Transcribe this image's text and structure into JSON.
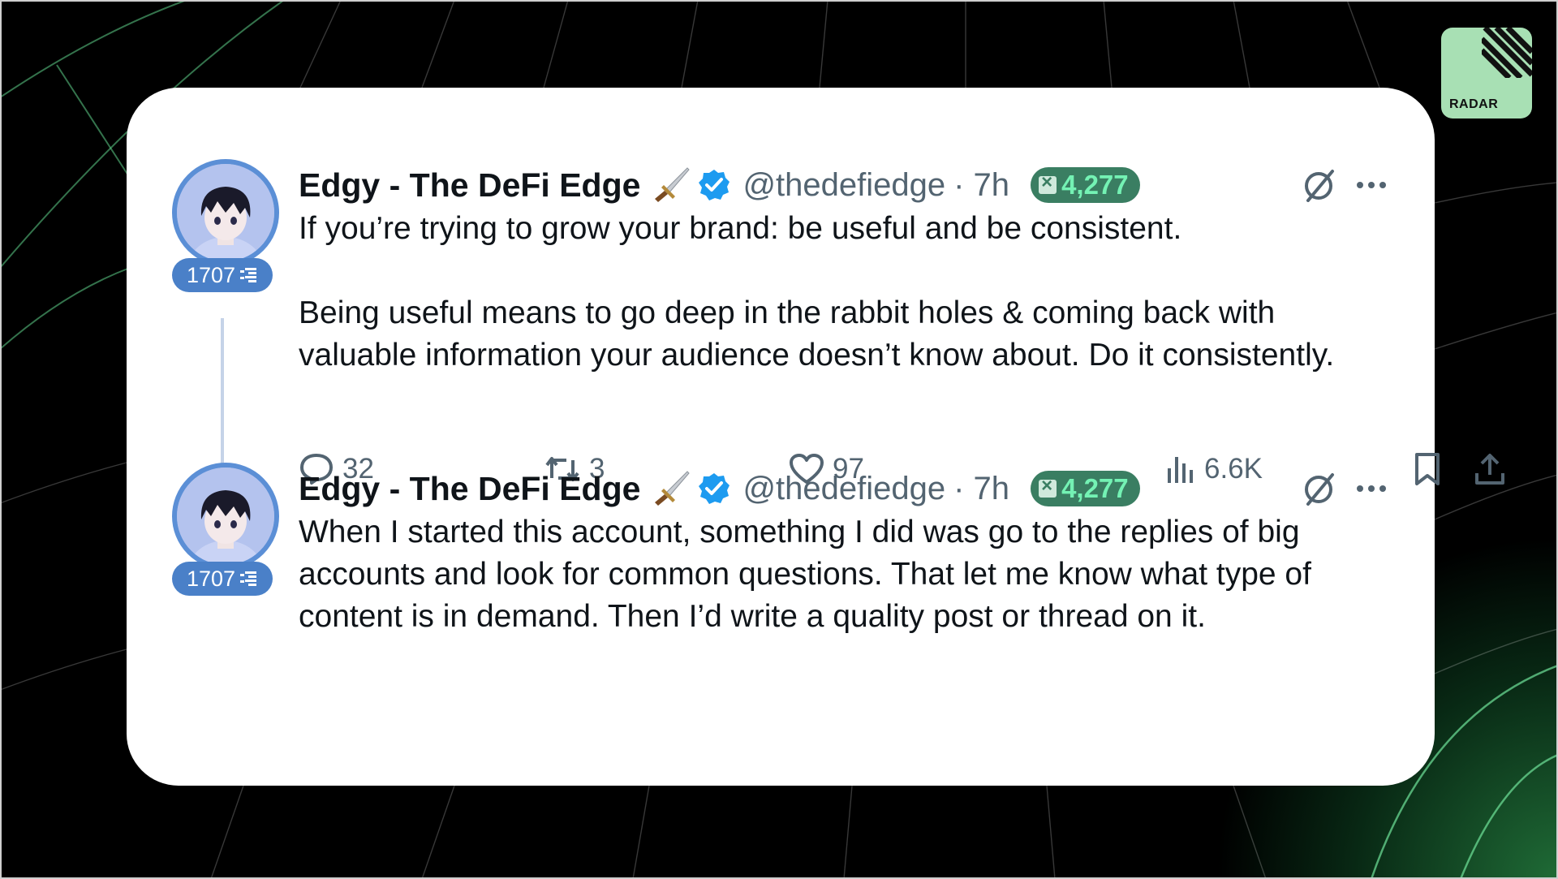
{
  "brand": {
    "logo_text": "RADAR",
    "accent": "#a8e0b4"
  },
  "tweets": [
    {
      "display_name": "Edgy - The DeFi Edge",
      "handle": "@thedefiedge",
      "time": "· 7h",
      "score": "4,277",
      "rank": "1707",
      "paragraphs": [
        "If you’re trying to grow your brand: be useful and be consistent.",
        "Being useful means to go deep in the rabbit holes & coming back with valuable information your audience doesn’t know about. Do it consistently."
      ],
      "stats": {
        "replies": "32",
        "reposts": "3",
        "likes": "97",
        "views": "6.6K"
      }
    },
    {
      "display_name": "Edgy - The DeFi Edge",
      "handle": "@thedefiedge",
      "time": "· 7h",
      "score": "4,277",
      "rank": "1707",
      "paragraphs": [
        "When I started this account, something I did was go to the replies of big accounts and look for common questions. That let me know what type of content is in demand. Then I’d write a quality post or thread on it."
      ]
    }
  ],
  "colors": {
    "verified": "#1d9bf0",
    "score_pill_bg": "#3a7e62",
    "score_pill_text": "#74f2b4",
    "rank_badge": "#4a80c8",
    "avatar_ring": "#5b8fd6"
  }
}
